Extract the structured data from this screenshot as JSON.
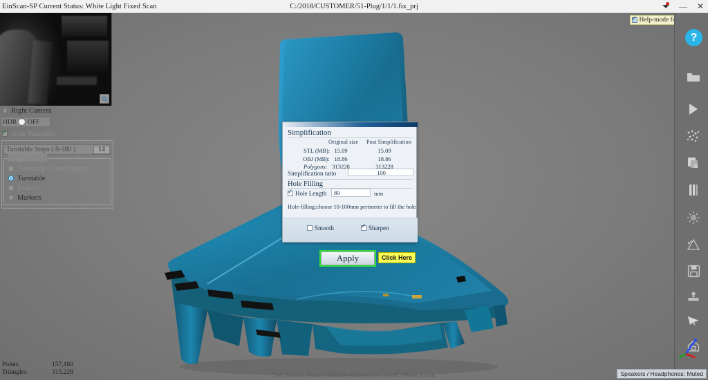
{
  "titlebar": {
    "status_text": "EinScan-SP Current Status: White Light Fixed Scan",
    "project_path": "C:/2018/CUSTOMER/51-Plug/1/1/1.fix_prj",
    "minimize_label": "—",
    "close_label": "✕",
    "caret_icon": "chevron-down-icon",
    "notification_dot_color": "#e02020"
  },
  "help_mode": {
    "label": "Help-mode for beginners",
    "checked": true
  },
  "camera_preview": {
    "caption": "Right Camera",
    "caption_checked": false,
    "zoom_icon": "magnifier-icon"
  },
  "hdr": {
    "label": "HDR",
    "state_label": "OFF"
  },
  "turntable": {
    "with_turntable_label": "With Turntable",
    "with_turntable_checked": true,
    "steps_label": "Turntable Steps ( 8-180 )",
    "steps_value": "14"
  },
  "align_mode": {
    "legend": "Align Mode:",
    "options": [
      {
        "label": "Turntable Coded Targets",
        "selected": false,
        "enabled": false,
        "control": "square"
      },
      {
        "label": "Turntable",
        "selected": true,
        "enabled": true,
        "control": "radio"
      },
      {
        "label": "Feature",
        "selected": false,
        "enabled": false,
        "control": "square"
      },
      {
        "label": "Markers",
        "selected": false,
        "enabled": true,
        "control": "radio"
      }
    ]
  },
  "dialog": {
    "section_simplification": "Simplification",
    "columns": [
      "Original size",
      "Post Simplification"
    ],
    "rows": [
      {
        "label": "STL (MB):",
        "original": "15.09",
        "post": "15.09"
      },
      {
        "label": "OBJ (MB):",
        "original": "18.86",
        "post": "18.86"
      },
      {
        "label": "Polygons:",
        "original": "313228",
        "post": "313228"
      }
    ],
    "ratio_label": "Simplification ratio",
    "ratio_value": "100",
    "section_hole_filling": "Hole Filling",
    "hole_length_label": "Hole Length",
    "hole_length_checked": true,
    "hole_length_value": "80",
    "hole_length_unit": "mm",
    "hint": "Hole-filling:choose 10-100mm perimeter to fill the hole",
    "smooth_label": "Smooth",
    "smooth_checked": false,
    "sharpen_label": "Sharpen",
    "sharpen_checked": true
  },
  "actions": {
    "apply_label": "Apply",
    "apply_highlight_color": "#2ee02e",
    "annotation_label": "Click Here",
    "annotation_bg": "#fdfd55"
  },
  "right_toolbar": {
    "help_label": "?",
    "help_color": "#29b5e8",
    "icons": [
      "folder-open-icon",
      "play-icon",
      "point-cloud-icon",
      "delete-scan-icon",
      "pause-icon",
      "brightness-icon",
      "calibration-icon",
      "save-icon",
      "export-icon",
      "cursor-icon",
      "home-icon"
    ],
    "axis_gizmo_icon": "axis-gizmo-icon"
  },
  "status": {
    "points_label": "Points",
    "points_value": "157,160",
    "triangles_label": "Triangles",
    "triangles_value": "313,228",
    "mouse_hint": "Left Mouse: Rotate | Middle Mouse Pan | Scroll Wheel Zoom",
    "audio_status": "Speakers / Headphones: Muted"
  },
  "model": {
    "mesh_color": "#1d7fa8",
    "mesh_color_light": "#2f9fd0",
    "mesh_color_dark": "#135d80"
  }
}
